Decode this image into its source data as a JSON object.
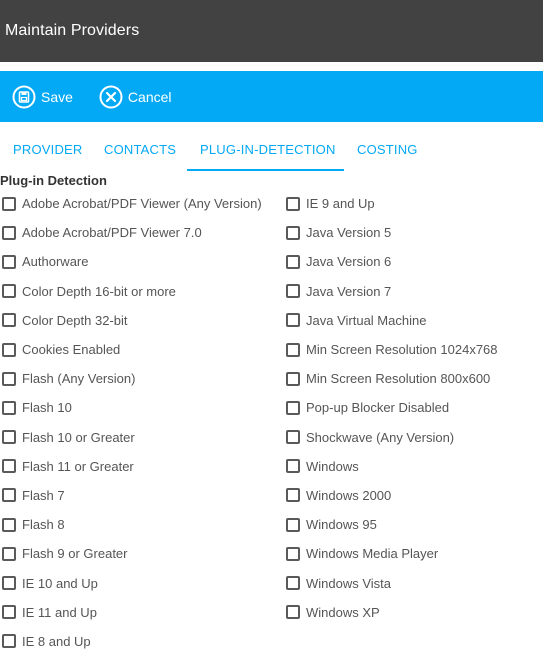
{
  "header": {
    "title": "Maintain Providers"
  },
  "toolbar": {
    "save_label": "Save",
    "cancel_label": "Cancel"
  },
  "tabs": [
    {
      "label": "PROVIDER",
      "active": false
    },
    {
      "label": "CONTACTS",
      "active": false
    },
    {
      "label": "PLUG-IN-DETECTION",
      "active": true
    },
    {
      "label": "COSTING",
      "active": false
    }
  ],
  "section_title": "Plug-in Detection",
  "left_items": [
    "Adobe Acrobat/PDF Viewer (Any Version)",
    "Adobe Acrobat/PDF Viewer 7.0",
    "Authorware",
    "Color Depth 16-bit or more",
    "Color Depth 32-bit",
    "Cookies Enabled",
    "Flash (Any Version)",
    "Flash 10",
    "Flash 10 or Greater",
    "Flash 11 or Greater",
    "Flash 7",
    "Flash 8",
    "Flash 9 or Greater",
    "IE 10 and Up",
    "IE 11 and Up",
    "IE 8 and Up"
  ],
  "right_items": [
    "IE 9 and Up",
    "Java Version 5",
    "Java Version 6",
    "Java Version 7",
    "Java Virtual Machine",
    "Min Screen Resolution 1024x768",
    "Min Screen Resolution 800x600",
    "Pop-up Blocker Disabled",
    "Shockwave (Any Version)",
    "Windows",
    "Windows 2000",
    "Windows 95",
    "Windows Media Player",
    "Windows Vista",
    "Windows XP"
  ],
  "colors": {
    "header_bg": "#424242",
    "accent": "#03a9f4"
  },
  "icons": {
    "save": "floppy-disk-icon",
    "cancel": "x-circle-icon"
  }
}
